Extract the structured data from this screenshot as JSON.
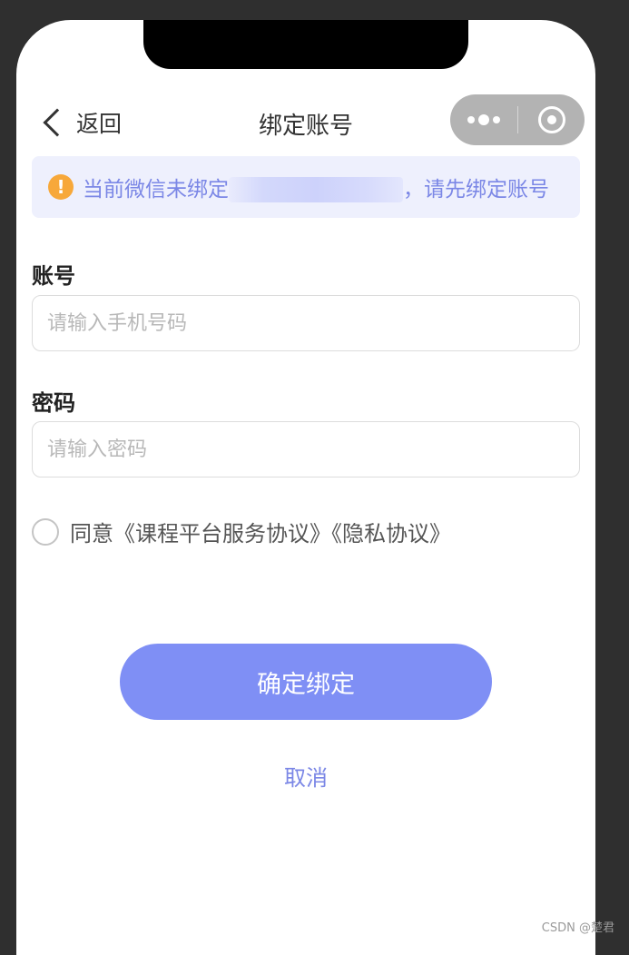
{
  "nav": {
    "back_label": "返回",
    "title": "绑定账号"
  },
  "notice": {
    "icon": "warning-icon",
    "icon_glyph": "!",
    "text_before": "当前微信未绑定",
    "text_after": "，请先绑定账号"
  },
  "form": {
    "account_label": "账号",
    "account_placeholder": "请输入手机号码",
    "account_value": "",
    "password_label": "密码",
    "password_placeholder": "请输入密码",
    "password_value": "",
    "agreement_text": "同意《课程平台服务协议》《隐私协议》",
    "agreement_checked": false
  },
  "actions": {
    "confirm_label": "确定绑定",
    "cancel_label": "取消"
  },
  "watermark": "CSDN @楚君",
  "colors": {
    "accent": "#7f8ff5",
    "notice_bg": "#eef0fd",
    "notice_text": "#7b87e6",
    "warning": "#f7a83a",
    "capsule": "#b3b3b3"
  }
}
